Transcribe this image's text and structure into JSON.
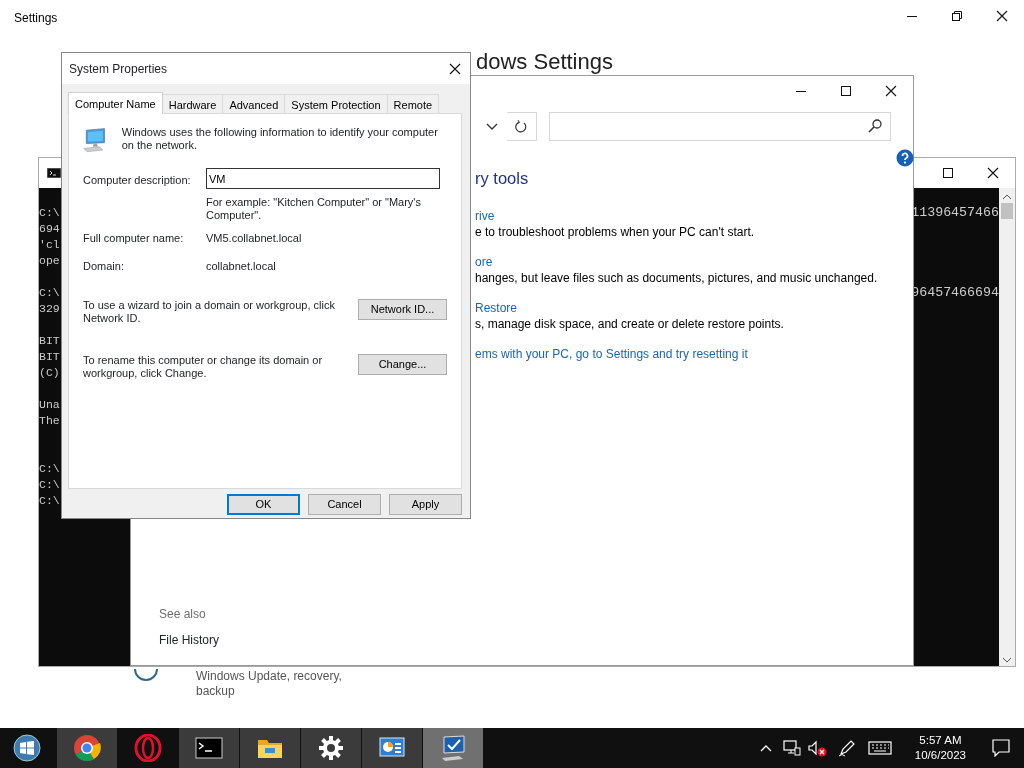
{
  "settings_window": {
    "title": "Settings",
    "heading": "dows Settings",
    "category_description": "Windows Update, recovery, backup"
  },
  "console_window": {
    "lines": [
      {
        "start": "C:\\",
        "end": "11396457466"
      },
      {
        "start": "694"
      },
      {
        "start": "'cl"
      },
      {
        "start": "ope"
      },
      {
        "blank": true
      },
      {
        "start": "C:\\",
        "end": "96457466694"
      },
      {
        "start": "329"
      },
      {
        "blank": true
      },
      {
        "start": "BIT"
      },
      {
        "start": "BIT"
      },
      {
        "start": "(C)"
      },
      {
        "blank": true
      },
      {
        "start": "Una"
      },
      {
        "start": "The"
      },
      {
        "blank": true
      },
      {
        "blank": true
      },
      {
        "start": "C:\\"
      },
      {
        "start": "C:\\"
      },
      {
        "start": "C:\\"
      }
    ]
  },
  "control_panel_window": {
    "heading": "ry tools",
    "items": [
      {
        "link": "rive",
        "description": "e to troubleshoot problems when your PC can't start."
      },
      {
        "link": "ore",
        "description": "hanges, but leave files such as documents, pictures, and music unchanged."
      },
      {
        "link": "Restore",
        "description": "s, manage disk space, and create or delete restore points."
      }
    ],
    "reset_link": "ems with your PC, go to Settings and try resetting it",
    "see_also": {
      "heading": "See also",
      "links": [
        "File History"
      ]
    }
  },
  "dialog": {
    "title": "System Properties",
    "tabs": [
      {
        "label": "Computer Name",
        "selected": true
      },
      {
        "label": "Hardware",
        "selected": false
      },
      {
        "label": "Advanced",
        "selected": false
      },
      {
        "label": "System Protection",
        "selected": false
      },
      {
        "label": "Remote",
        "selected": false
      }
    ],
    "intro": "Windows uses the following information to identify your computer on the network.",
    "description_field": {
      "label": "Computer description:",
      "value": "VM",
      "hint": "For example: \"Kitchen Computer\" or \"Mary's Computer\"."
    },
    "info_rows": [
      {
        "label": "Full computer name:",
        "value": "VM5.collabnet.local"
      },
      {
        "label": "Domain:",
        "value": "collabnet.local"
      }
    ],
    "actions": [
      {
        "text": "To use a wizard to join a domain or workgroup, click Network ID.",
        "button": "Network ID..."
      },
      {
        "text": "To rename this computer or change its domain or workgroup, click Change.",
        "button": "Change..."
      }
    ],
    "buttons": [
      {
        "label": "OK",
        "default": true
      },
      {
        "label": "Cancel",
        "default": false
      },
      {
        "label": "Apply",
        "default": false
      }
    ]
  },
  "taskbar": {
    "apps": [
      {
        "kind": "chrome",
        "running": true,
        "active": false
      },
      {
        "kind": "opera",
        "running": false,
        "active": false
      },
      {
        "kind": "console",
        "running": true,
        "active": false
      },
      {
        "kind": "folder",
        "running": true,
        "active": false
      },
      {
        "kind": "gear",
        "running": true,
        "active": false
      },
      {
        "kind": "control-panel",
        "running": true,
        "active": false
      },
      {
        "kind": "system",
        "running": true,
        "active": true
      }
    ],
    "volume_muted": true,
    "time": "5:57 AM",
    "date": "10/6/2023"
  }
}
